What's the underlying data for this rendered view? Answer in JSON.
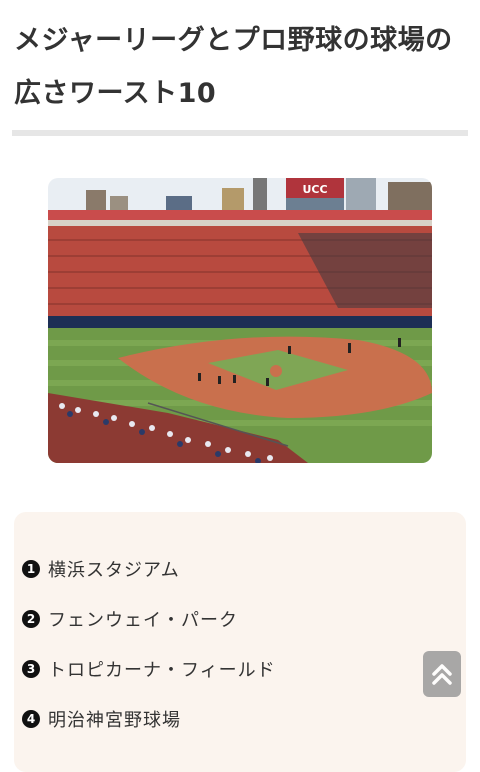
{
  "article": {
    "title": "メジャーリーグとプロ野球の球場の広さワースト10"
  },
  "ranking": {
    "items": [
      {
        "rank": "1",
        "name": "横浜スタジアム"
      },
      {
        "rank": "2",
        "name": "フェンウェイ・パーク"
      },
      {
        "rank": "3",
        "name": "トロピカーナ・フィールド"
      },
      {
        "rank": "4",
        "name": "明治神宮野球場"
      }
    ]
  },
  "stadium_sign": "UCC",
  "icons": {
    "scroll_top": "double-chevron-up-icon",
    "photo": "baseball-stadium-photo"
  },
  "colors": {
    "title_text": "#333333",
    "rule": "#e6e6e6",
    "list_bg": "#fbf4ee",
    "badge": "#111111",
    "scroll_button": "#9a9a9a"
  }
}
